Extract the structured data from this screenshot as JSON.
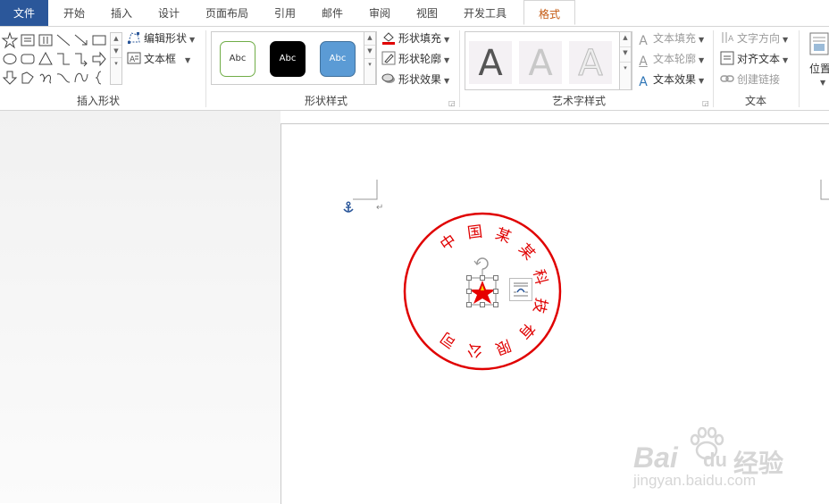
{
  "tabs": [
    {
      "label": "文件"
    },
    {
      "label": "开始"
    },
    {
      "label": "插入"
    },
    {
      "label": "设计"
    },
    {
      "label": "页面布局"
    },
    {
      "label": "引用"
    },
    {
      "label": "邮件"
    },
    {
      "label": "审阅"
    },
    {
      "label": "视图"
    },
    {
      "label": "开发工具"
    },
    {
      "label": "格式"
    }
  ],
  "active_tab": "格式",
  "ribbon": {
    "insert_shapes": {
      "label": "插入形状",
      "edit_shape_label": "编辑形状",
      "text_box_label": "文本框"
    },
    "shape_styles": {
      "label": "形状样式",
      "presets": [
        {
          "text": "Abc"
        },
        {
          "text": "Abc"
        },
        {
          "text": "Abc"
        }
      ],
      "fill_label": "形状填充",
      "outline_label": "形状轮廓",
      "effects_label": "形状效果"
    },
    "wordart_styles": {
      "label": "艺术字样式",
      "presets": [
        {
          "text": "A"
        },
        {
          "text": "A"
        },
        {
          "text": "A"
        }
      ],
      "text_fill_label": "文本填充",
      "text_outline_label": "文本轮廓",
      "text_effects_label": "文本效果"
    },
    "text": {
      "label": "文本",
      "direction_label": "文字方向",
      "align_label": "对齐文本",
      "link_label": "创建链接"
    },
    "arrange": {
      "position_label": "位置"
    }
  },
  "document": {
    "seal_text_chars": [
      "中",
      "国",
      "某",
      "某",
      "科",
      "技",
      "有",
      "限",
      "公",
      "司"
    ],
    "paragraph_mark": "↵"
  },
  "watermark": {
    "brand": "Bai",
    "brand2": "du",
    "cn": "经验",
    "url": "jingyan.baidu.com"
  },
  "colors": {
    "accent_blue": "#2b579a",
    "format_tab": "#c55a11",
    "seal_red": "#e00000"
  }
}
